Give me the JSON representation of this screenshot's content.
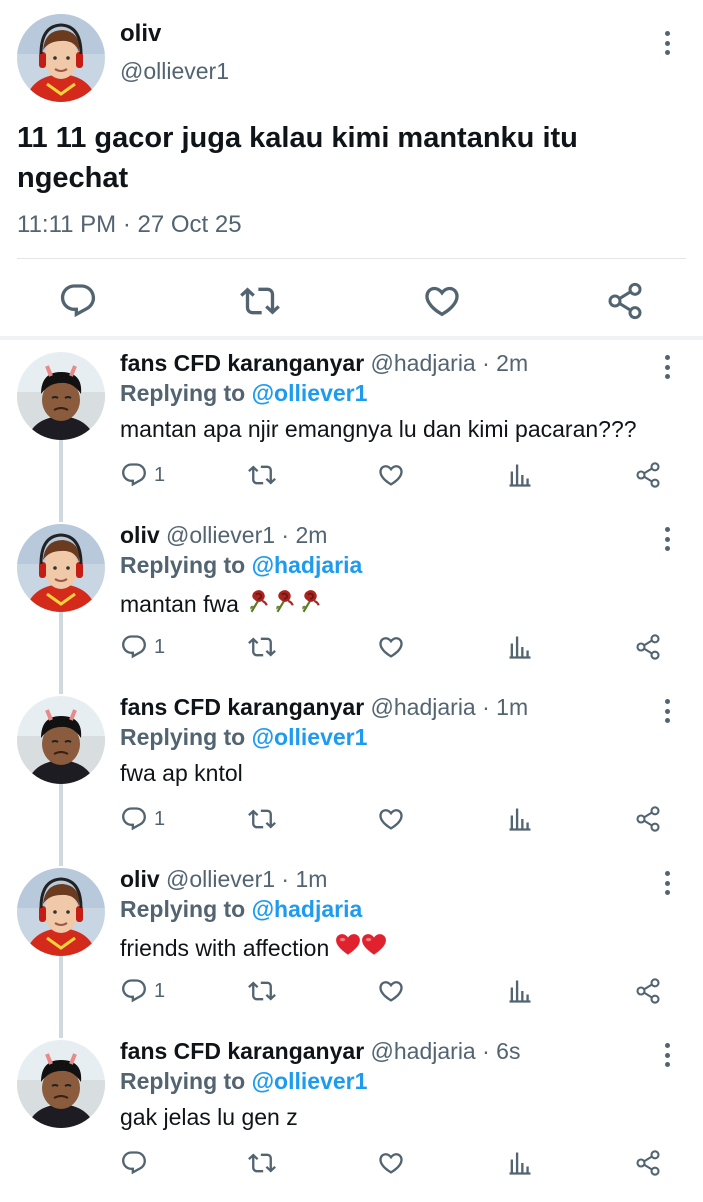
{
  "main_tweet": {
    "name": "oliv",
    "handle": "@olliever1",
    "text": "11 11 gacor juga kalau kimi mantanku itu ngechat",
    "time": "11:11 PM · 27 Oct 25",
    "avatar_icon": "avatar-oliv",
    "actions": [
      "reply-icon",
      "retweet-icon",
      "like-icon",
      "share-icon"
    ]
  },
  "replies": [
    {
      "name": "fans CFD karanganyar",
      "meta": "@hadjaria · 2m",
      "replying_label": "Replying to",
      "replying_to": "@olliever1",
      "text": "mantan apa njir emangnya lu dan kimi pacaran???",
      "reply_count": "1",
      "avatar_icon": "avatar-fans"
    },
    {
      "name": "oliv",
      "meta": "@olliever1 · 2m",
      "replying_label": "Replying to",
      "replying_to": "@hadjaria",
      "text": "mantan fwa",
      "emoji": "wilted-rose-emoji x3",
      "reply_count": "1",
      "avatar_icon": "avatar-oliv"
    },
    {
      "name": "fans CFD karanganyar",
      "meta": "@hadjaria · 1m",
      "replying_label": "Replying to",
      "replying_to": "@olliever1",
      "text": "fwa ap kntol",
      "reply_count": "1",
      "avatar_icon": "avatar-fans"
    },
    {
      "name": "oliv",
      "meta": "@olliever1 · 1m",
      "replying_label": "Replying to",
      "replying_to": "@hadjaria",
      "text": "friends with affection",
      "emoji": "red-heart-emoji x2",
      "reply_count": "1",
      "avatar_icon": "avatar-oliv"
    },
    {
      "name": "fans CFD karanganyar",
      "meta": "@hadjaria · 6s",
      "replying_label": "Replying to",
      "replying_to": "@olliever1",
      "text": "gak jelas lu gen z",
      "reply_count": "",
      "avatar_icon": "avatar-fans"
    }
  ],
  "colors": {
    "accent": "#1d9bf0",
    "text": "#0f1419",
    "muted": "#536471",
    "divider": "#e5e5e5"
  }
}
